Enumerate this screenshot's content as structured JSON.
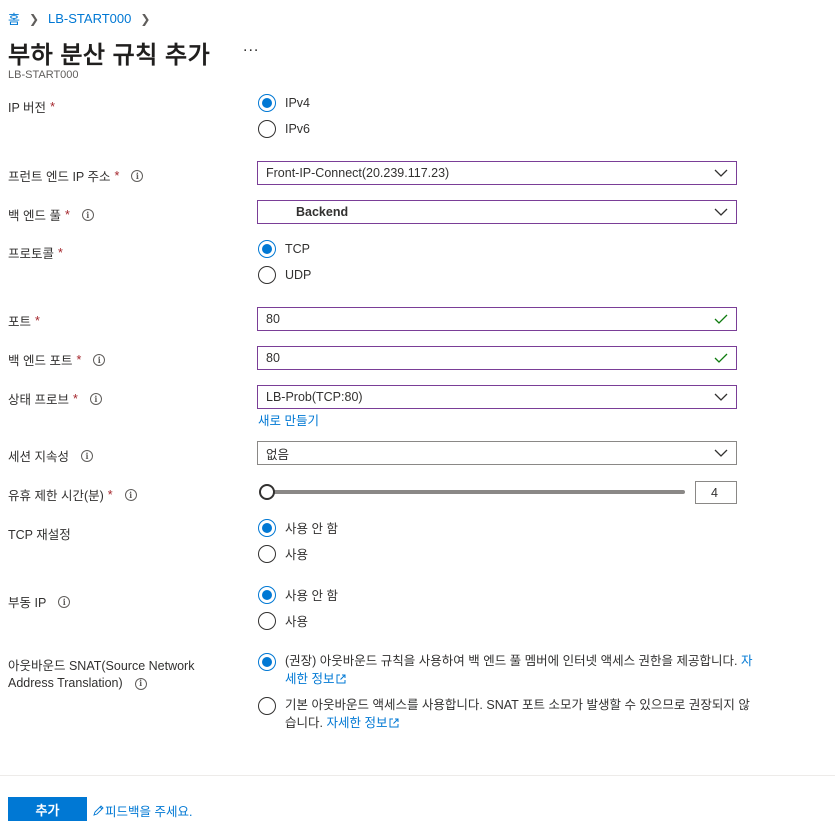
{
  "breadcrumb": {
    "home": "홈",
    "resource": "LB-START000"
  },
  "header": {
    "title": "부하 분산 규칙 추가",
    "more": "...",
    "subtitle": "LB-START000"
  },
  "form": {
    "ip_version": {
      "label": "IP 버전",
      "required": "*",
      "options": [
        "IPv4",
        "IPv6"
      ],
      "selected": "IPv4"
    },
    "frontend_ip": {
      "label": "프런트 엔드 IP 주소",
      "required": "*",
      "value": "Front-IP-Connect(20.239.117.23)"
    },
    "backend_pool": {
      "label": "백 엔드 풀",
      "required": "*",
      "value": "Backend"
    },
    "protocol": {
      "label": "프로토콜",
      "required": "*",
      "options": [
        "TCP",
        "UDP"
      ],
      "selected": "TCP"
    },
    "port": {
      "label": "포트",
      "required": "*",
      "value": "80"
    },
    "backend_port": {
      "label": "백 엔드 포트",
      "required": "*",
      "value": "80"
    },
    "health_probe": {
      "label": "상태 프로브",
      "required": "*",
      "value": "LB-Prob(TCP:80)",
      "create_new": "새로 만들기"
    },
    "session_persistence": {
      "label": "세션 지속성",
      "value": "없음"
    },
    "idle_timeout": {
      "label": "유휴 제한 시간(분)",
      "required": "*",
      "value": "4",
      "slider_fraction": 0
    },
    "tcp_reset": {
      "label": "TCP 재설정",
      "options": [
        "사용 안 함",
        "사용"
      ],
      "selected": "사용 안 함"
    },
    "floating_ip": {
      "label": "부동 IP",
      "options": [
        "사용 안 함",
        "사용"
      ],
      "selected": "사용 안 함"
    },
    "outbound_snat": {
      "label_line1": "아웃바운드 SNAT(Source Network",
      "label_line2": "Address Translation)",
      "option1_text": "(권장) 아웃바운드 규칙을 사용하여 백 엔드 풀 멤버에 인터넷 액세스 권한을 제공합니다.",
      "option1_link": "자세한 정보",
      "option2_text": "기본 아웃바운드 액세스를 사용합니다. SNAT 포트 소모가 발생할 수 있으므로 권장되지 않습니다.",
      "option2_link": "자세한 정보"
    }
  },
  "footer": {
    "add_button": "추가",
    "feedback": "피드백을 주세요."
  },
  "colors": {
    "accent": "#0078d4",
    "required": "#a4262c",
    "focus_border": "#7a3e97",
    "validation_check": "#107c10"
  },
  "icons": {
    "info": "info-icon",
    "dropdown": "chevron-down-icon",
    "valid": "checkmark-icon",
    "external": "external-link-icon",
    "feedback": "feedback-icon"
  }
}
